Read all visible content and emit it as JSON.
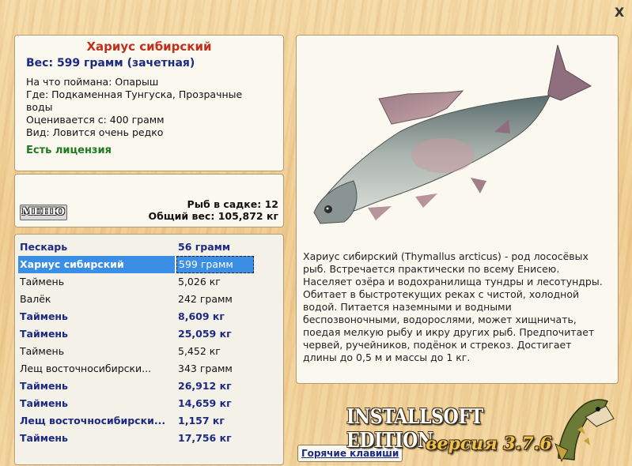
{
  "window": {
    "close_label": "X"
  },
  "info": {
    "title": "Хариус сибирский",
    "weight": "Вес: 599 грамм (зачетная)",
    "lines": [
      "На что поймана: Опарыш",
      "Где: Подкаменная Тунгуска, Прозрачные воды",
      "Оценивается с: 400 грамм",
      "Вид: Ловится очень редко"
    ],
    "license": "Есть лицензия"
  },
  "summary": {
    "menu_label": "МЕНЮ",
    "count": "Рыб в садке: 12",
    "total": "Общий вес: 105,872 кг"
  },
  "catch": [
    {
      "name": "Пескарь",
      "weight": "56 грамм",
      "style": "bold"
    },
    {
      "name": "Хариус сибирский",
      "weight": "599 грамм",
      "style": "sel"
    },
    {
      "name": "Таймень",
      "weight": "5,026 кг",
      "style": "plain"
    },
    {
      "name": "Валёк",
      "weight": "242 грамм",
      "style": "plain"
    },
    {
      "name": "Таймень",
      "weight": "8,609 кг",
      "style": "bold"
    },
    {
      "name": "Таймень",
      "weight": "25,059 кг",
      "style": "bold"
    },
    {
      "name": "Таймень",
      "weight": "5,452 кг",
      "style": "plain"
    },
    {
      "name": "Лещ восточносибирски...",
      "weight": "343 грамм",
      "style": "plain"
    },
    {
      "name": "Таймень",
      "weight": "26,912 кг",
      "style": "bold"
    },
    {
      "name": "Таймень",
      "weight": "14,659 кг",
      "style": "bold"
    },
    {
      "name": "Лещ восточносибирски...",
      "weight": "1,157 кг",
      "style": "bold"
    },
    {
      "name": "Таймень",
      "weight": "17,756 кг",
      "style": "bold"
    }
  ],
  "description": "Хариус сибирский (Thymallus arcticus) - род лососёвых рыб. Встречается практически по всему Енисею. Населяет озёра и водохранилища тундры и лесотундры. Обитает в быстротекущих реках с чистой, холодной водой. Питается наземными и водными беспозвоночными, водорослями, может хищничать, поедая мелкую рыбу и икру других рыб. Предпочитает червей, ручейников, подёнок и стрекоз. Достигает длины до 0,5 м и массы до 1 кг.",
  "footer": {
    "hotkeys_label": "Горячие клавиши",
    "edition": "INSTALLSOFT EDITION",
    "version": "версия 3.7.6"
  },
  "icons": {
    "close": "close-icon",
    "fish": "grayling-fish-image",
    "logo": "pike-logo-icon"
  }
}
